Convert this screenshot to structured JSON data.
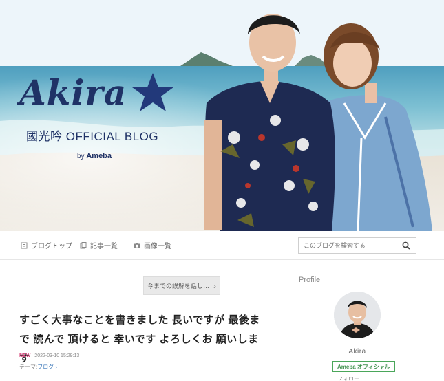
{
  "header": {
    "brand_script": "Akira",
    "brand_subtitle": "國光吟 OFFICIAL BLOG",
    "brand_by_prefix": "by",
    "brand_by_name": "Ameba",
    "star_color": "#22397a",
    "brand_color": "#1f3266"
  },
  "nav": {
    "items": [
      {
        "label": "ブログトップ",
        "icon": "blog-top-icon"
      },
      {
        "label": "記事一覧",
        "icon": "entry-list-icon"
      },
      {
        "label": "画像一覧",
        "icon": "camera-icon"
      }
    ],
    "search_placeholder": "このブログを検索する"
  },
  "main": {
    "prev_entry_label": "今までの誤解を話し…",
    "article_title": "すごく大事なことを書きました 長いですが 最後まで 読んで 頂けると 幸いです よろしくお 願いします",
    "new_badge": "NEW",
    "timestamp": "2022-03-10 15:29:13",
    "theme_prefix": "テーマ:",
    "theme_name": "ブログ",
    "theme_chevron": "›"
  },
  "sidebar": {
    "profile_heading": "Profile",
    "profile_name": "Akira",
    "official_badge": "Ameba オフィシャル",
    "cut_text": "フォロー"
  },
  "colors": {
    "new_badge": "#d6457b",
    "link": "#3a76b8",
    "official_badge": "#4aa65a"
  }
}
